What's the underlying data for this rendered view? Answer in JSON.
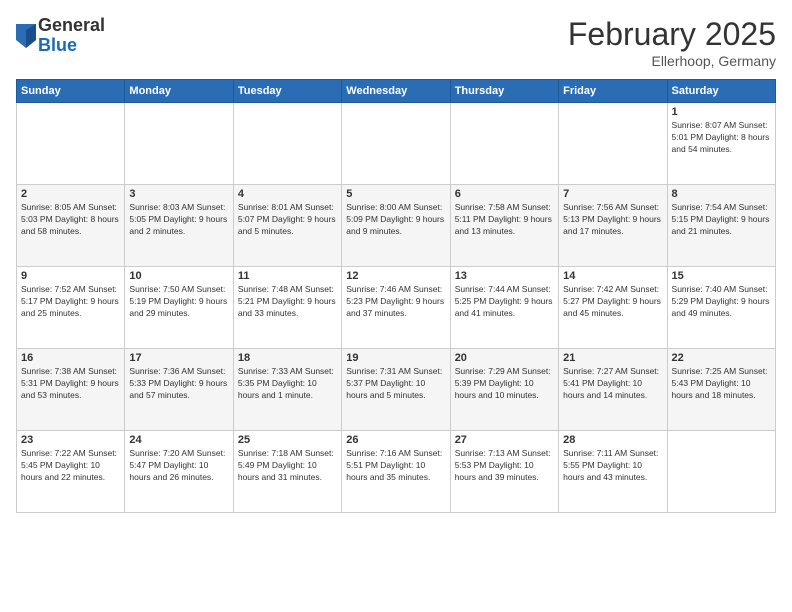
{
  "header": {
    "logo": {
      "general": "General",
      "blue": "Blue"
    },
    "title": "February 2025",
    "location": "Ellerhoop, Germany"
  },
  "weekdays": [
    "Sunday",
    "Monday",
    "Tuesday",
    "Wednesday",
    "Thursday",
    "Friday",
    "Saturday"
  ],
  "weeks": [
    [
      {
        "day": "",
        "info": ""
      },
      {
        "day": "",
        "info": ""
      },
      {
        "day": "",
        "info": ""
      },
      {
        "day": "",
        "info": ""
      },
      {
        "day": "",
        "info": ""
      },
      {
        "day": "",
        "info": ""
      },
      {
        "day": "1",
        "info": "Sunrise: 8:07 AM\nSunset: 5:01 PM\nDaylight: 8 hours and 54 minutes."
      }
    ],
    [
      {
        "day": "2",
        "info": "Sunrise: 8:05 AM\nSunset: 5:03 PM\nDaylight: 8 hours and 58 minutes."
      },
      {
        "day": "3",
        "info": "Sunrise: 8:03 AM\nSunset: 5:05 PM\nDaylight: 9 hours and 2 minutes."
      },
      {
        "day": "4",
        "info": "Sunrise: 8:01 AM\nSunset: 5:07 PM\nDaylight: 9 hours and 5 minutes."
      },
      {
        "day": "5",
        "info": "Sunrise: 8:00 AM\nSunset: 5:09 PM\nDaylight: 9 hours and 9 minutes."
      },
      {
        "day": "6",
        "info": "Sunrise: 7:58 AM\nSunset: 5:11 PM\nDaylight: 9 hours and 13 minutes."
      },
      {
        "day": "7",
        "info": "Sunrise: 7:56 AM\nSunset: 5:13 PM\nDaylight: 9 hours and 17 minutes."
      },
      {
        "day": "8",
        "info": "Sunrise: 7:54 AM\nSunset: 5:15 PM\nDaylight: 9 hours and 21 minutes."
      }
    ],
    [
      {
        "day": "9",
        "info": "Sunrise: 7:52 AM\nSunset: 5:17 PM\nDaylight: 9 hours and 25 minutes."
      },
      {
        "day": "10",
        "info": "Sunrise: 7:50 AM\nSunset: 5:19 PM\nDaylight: 9 hours and 29 minutes."
      },
      {
        "day": "11",
        "info": "Sunrise: 7:48 AM\nSunset: 5:21 PM\nDaylight: 9 hours and 33 minutes."
      },
      {
        "day": "12",
        "info": "Sunrise: 7:46 AM\nSunset: 5:23 PM\nDaylight: 9 hours and 37 minutes."
      },
      {
        "day": "13",
        "info": "Sunrise: 7:44 AM\nSunset: 5:25 PM\nDaylight: 9 hours and 41 minutes."
      },
      {
        "day": "14",
        "info": "Sunrise: 7:42 AM\nSunset: 5:27 PM\nDaylight: 9 hours and 45 minutes."
      },
      {
        "day": "15",
        "info": "Sunrise: 7:40 AM\nSunset: 5:29 PM\nDaylight: 9 hours and 49 minutes."
      }
    ],
    [
      {
        "day": "16",
        "info": "Sunrise: 7:38 AM\nSunset: 5:31 PM\nDaylight: 9 hours and 53 minutes."
      },
      {
        "day": "17",
        "info": "Sunrise: 7:36 AM\nSunset: 5:33 PM\nDaylight: 9 hours and 57 minutes."
      },
      {
        "day": "18",
        "info": "Sunrise: 7:33 AM\nSunset: 5:35 PM\nDaylight: 10 hours and 1 minute."
      },
      {
        "day": "19",
        "info": "Sunrise: 7:31 AM\nSunset: 5:37 PM\nDaylight: 10 hours and 5 minutes."
      },
      {
        "day": "20",
        "info": "Sunrise: 7:29 AM\nSunset: 5:39 PM\nDaylight: 10 hours and 10 minutes."
      },
      {
        "day": "21",
        "info": "Sunrise: 7:27 AM\nSunset: 5:41 PM\nDaylight: 10 hours and 14 minutes."
      },
      {
        "day": "22",
        "info": "Sunrise: 7:25 AM\nSunset: 5:43 PM\nDaylight: 10 hours and 18 minutes."
      }
    ],
    [
      {
        "day": "23",
        "info": "Sunrise: 7:22 AM\nSunset: 5:45 PM\nDaylight: 10 hours and 22 minutes."
      },
      {
        "day": "24",
        "info": "Sunrise: 7:20 AM\nSunset: 5:47 PM\nDaylight: 10 hours and 26 minutes."
      },
      {
        "day": "25",
        "info": "Sunrise: 7:18 AM\nSunset: 5:49 PM\nDaylight: 10 hours and 31 minutes."
      },
      {
        "day": "26",
        "info": "Sunrise: 7:16 AM\nSunset: 5:51 PM\nDaylight: 10 hours and 35 minutes."
      },
      {
        "day": "27",
        "info": "Sunrise: 7:13 AM\nSunset: 5:53 PM\nDaylight: 10 hours and 39 minutes."
      },
      {
        "day": "28",
        "info": "Sunrise: 7:11 AM\nSunset: 5:55 PM\nDaylight: 10 hours and 43 minutes."
      },
      {
        "day": "",
        "info": ""
      }
    ]
  ]
}
